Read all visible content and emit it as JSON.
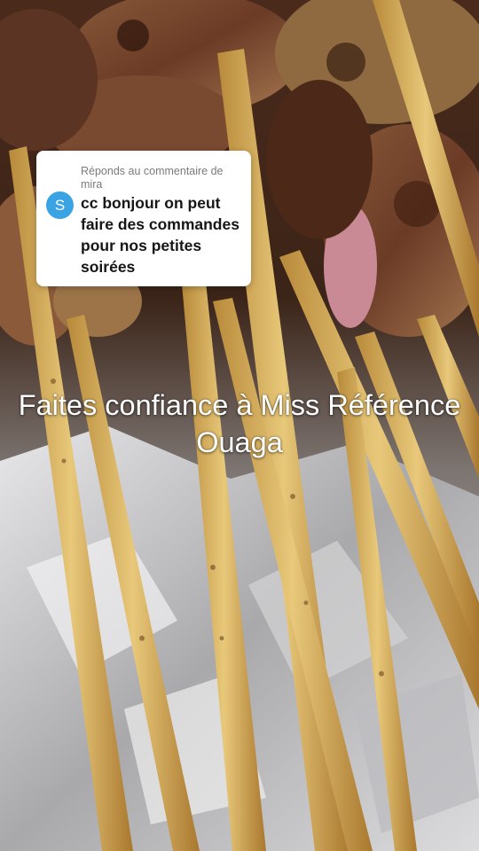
{
  "reply_card": {
    "label": "Réponds au commentaire de mira",
    "avatar_letter": "S",
    "comment": "cc bonjour on peut faire des commandes pour nos petites soirées",
    "avatar_color": "#3aa3e3"
  },
  "caption": {
    "text": "Faites confiance à Miss Référence Ouaga"
  },
  "scene": {
    "description_icon": "grilled-skewers-photo"
  }
}
